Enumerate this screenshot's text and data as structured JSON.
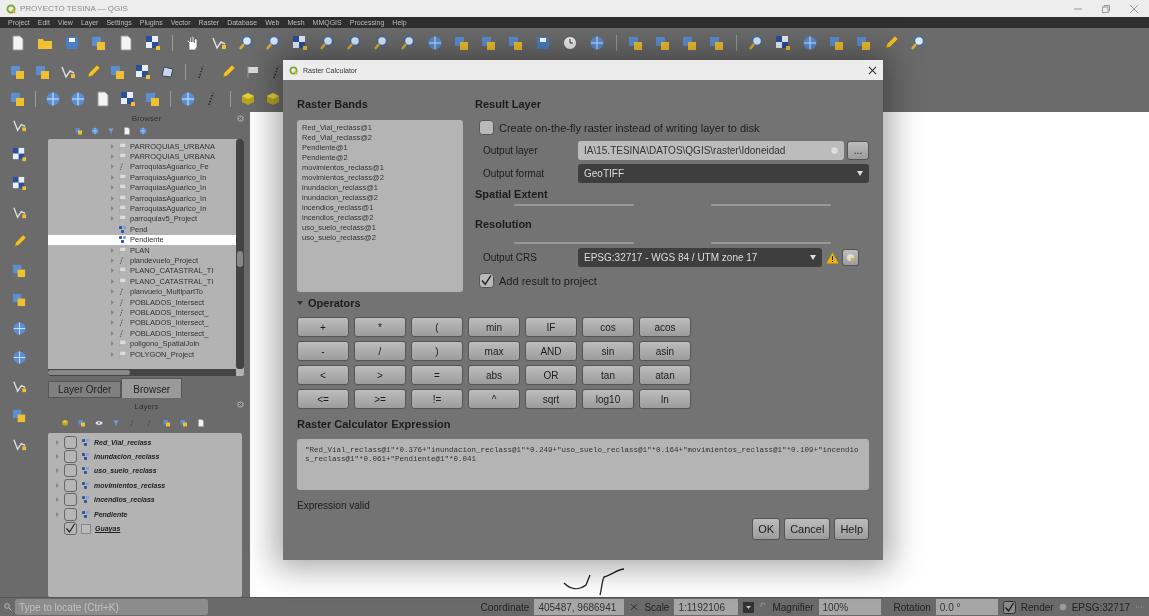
{
  "window": {
    "title": "PROYECTO TESINA — QGIS"
  },
  "menu": [
    "Project",
    "Edit",
    "View",
    "Layer",
    "Settings",
    "Plugins",
    "Vector",
    "Raster",
    "Database",
    "Web",
    "Mesh",
    "MMQGIS",
    "Processing",
    "Help"
  ],
  "browser": {
    "title": "Browser",
    "items": [
      {
        "label": "PARROQUIAS_URBANA",
        "kind": "group",
        "selected": false
      },
      {
        "label": "PARROQUIAS_URBANA",
        "kind": "group",
        "selected": false
      },
      {
        "label": "ParroquiasAguarico_Fe",
        "kind": "vector",
        "selected": false
      },
      {
        "label": "ParroquiasAguarico_In",
        "kind": "group",
        "selected": false
      },
      {
        "label": "ParroquiasAguarico_In",
        "kind": "group",
        "selected": false
      },
      {
        "label": "ParroquiasAguarico_In",
        "kind": "group",
        "selected": false
      },
      {
        "label": "ParroquiasAguarico_In",
        "kind": "group",
        "selected": false
      },
      {
        "label": "parroquiav5_Project",
        "kind": "group",
        "selected": false
      },
      {
        "label": "Pend",
        "kind": "raster",
        "selected": false
      },
      {
        "label": "Pendiente",
        "kind": "raster",
        "selected": true
      },
      {
        "label": "PLAN",
        "kind": "group",
        "selected": false
      },
      {
        "label": "plandevuelo_Project",
        "kind": "vector",
        "selected": false
      },
      {
        "label": "PLANO_CATASTRAL_TI",
        "kind": "group",
        "selected": false
      },
      {
        "label": "PLANO_CATASTRAL_TI",
        "kind": "group",
        "selected": false
      },
      {
        "label": "planvuelo_MultipartTo",
        "kind": "vector",
        "selected": false
      },
      {
        "label": "POBLADOS_Intersect",
        "kind": "vector",
        "selected": false
      },
      {
        "label": "POBLADOS_Intersect_",
        "kind": "vector",
        "selected": false
      },
      {
        "label": "POBLADOS_Intersect_",
        "kind": "vector",
        "selected": false
      },
      {
        "label": "POBLADOS_Intersect_",
        "kind": "vector",
        "selected": false
      },
      {
        "label": "poligono_SpatialJoin",
        "kind": "group",
        "selected": false
      },
      {
        "label": "POLYGON_Project",
        "kind": "group",
        "selected": false
      }
    ]
  },
  "panel_tabs": [
    {
      "label": "Layer Order",
      "selected": false
    },
    {
      "label": "Browser",
      "selected": true
    }
  ],
  "layers": {
    "title": "Layers",
    "items": [
      {
        "label": "Red_Vial_reclass",
        "kind": "raster",
        "checked": false
      },
      {
        "label": "inundacion_reclass",
        "kind": "raster",
        "checked": false
      },
      {
        "label": "uso_suelo_reclass",
        "kind": "raster",
        "checked": false
      },
      {
        "label": "movimientos_reclass",
        "kind": "raster",
        "checked": false
      },
      {
        "label": "incendios_reclass",
        "kind": "raster",
        "checked": false
      },
      {
        "label": "Pendiente",
        "kind": "raster",
        "checked": false
      },
      {
        "label": "Guayas",
        "kind": "vector",
        "checked": true
      }
    ]
  },
  "locator": {
    "placeholder": "Type to locate (Ctrl+K)"
  },
  "dialog": {
    "title": "Raster Calculator",
    "raster_bands": {
      "title": "Raster Bands",
      "items": [
        "Red_Vial_reclass@1",
        "Red_Vial_reclass@2",
        "Pendiente@1",
        "Pendiente@2",
        "movimientos_reclass@1",
        "movimientos_reclass@2",
        "inundacion_reclass@1",
        "inundacion_reclass@2",
        "incendios_reclass@1",
        "incendios_reclass@2",
        "uso_suelo_reclass@1",
        "uso_suelo_reclass@2"
      ]
    },
    "result_layer": {
      "title": "Result Layer",
      "on_the_fly": {
        "label": "Create on-the-fly raster instead of writing layer to disk",
        "checked": false
      },
      "output_layer_label": "Output layer",
      "output_layer": "IA\\15.TESINA\\DATOS\\QGIS\\raster\\Idoneidad",
      "browse": "...",
      "output_format_label": "Output format",
      "output_format": "GeoTIFF",
      "spatial_extent": "Spatial Extent",
      "resolution": "Resolution",
      "output_crs_label": "Output CRS",
      "output_crs": "EPSG:32717 - WGS 84 / UTM zone 17",
      "add_to_project": {
        "label": "Add result to project",
        "checked": true
      }
    },
    "operators": {
      "title": "Operators",
      "expanded": true,
      "buttons": [
        "+",
        "*",
        "(",
        "min",
        "IF",
        "cos",
        "acos",
        "-",
        "/",
        ")",
        "max",
        "AND",
        "sin",
        "asin",
        "<",
        ">",
        "=",
        "abs",
        "OR",
        "tan",
        "atan",
        "<=",
        ">=",
        "!=",
        "^",
        "sqrt",
        "log10",
        "ln"
      ]
    },
    "expression": {
      "title": "Raster Calculator Expression",
      "value": "\"Red_Vial_reclass@1\"*0.376+\"inundacion_reclass@1\"*0.249+\"uso_suelo_reclass@1\"*0.164+\"movimientos_reclass@1\"*0.109+\"incendios_reclass@1\"*0.061+\"Pendiente@1\"*0.041",
      "status": "Expression valid"
    },
    "buttons": [
      "OK",
      "Cancel",
      "Help"
    ]
  },
  "status_bar": {
    "coordinate_label": "Coordinate",
    "coordinate": "405487, 9686941",
    "scale_label": "Scale",
    "scale": "1:1192106",
    "magnifier_label": "Magnifier",
    "magnifier": "100%",
    "rotation_label": "Rotation",
    "rotation": "0.0 °",
    "render": {
      "label": "Render",
      "checked": true
    },
    "crs": "EPSG:32717"
  }
}
